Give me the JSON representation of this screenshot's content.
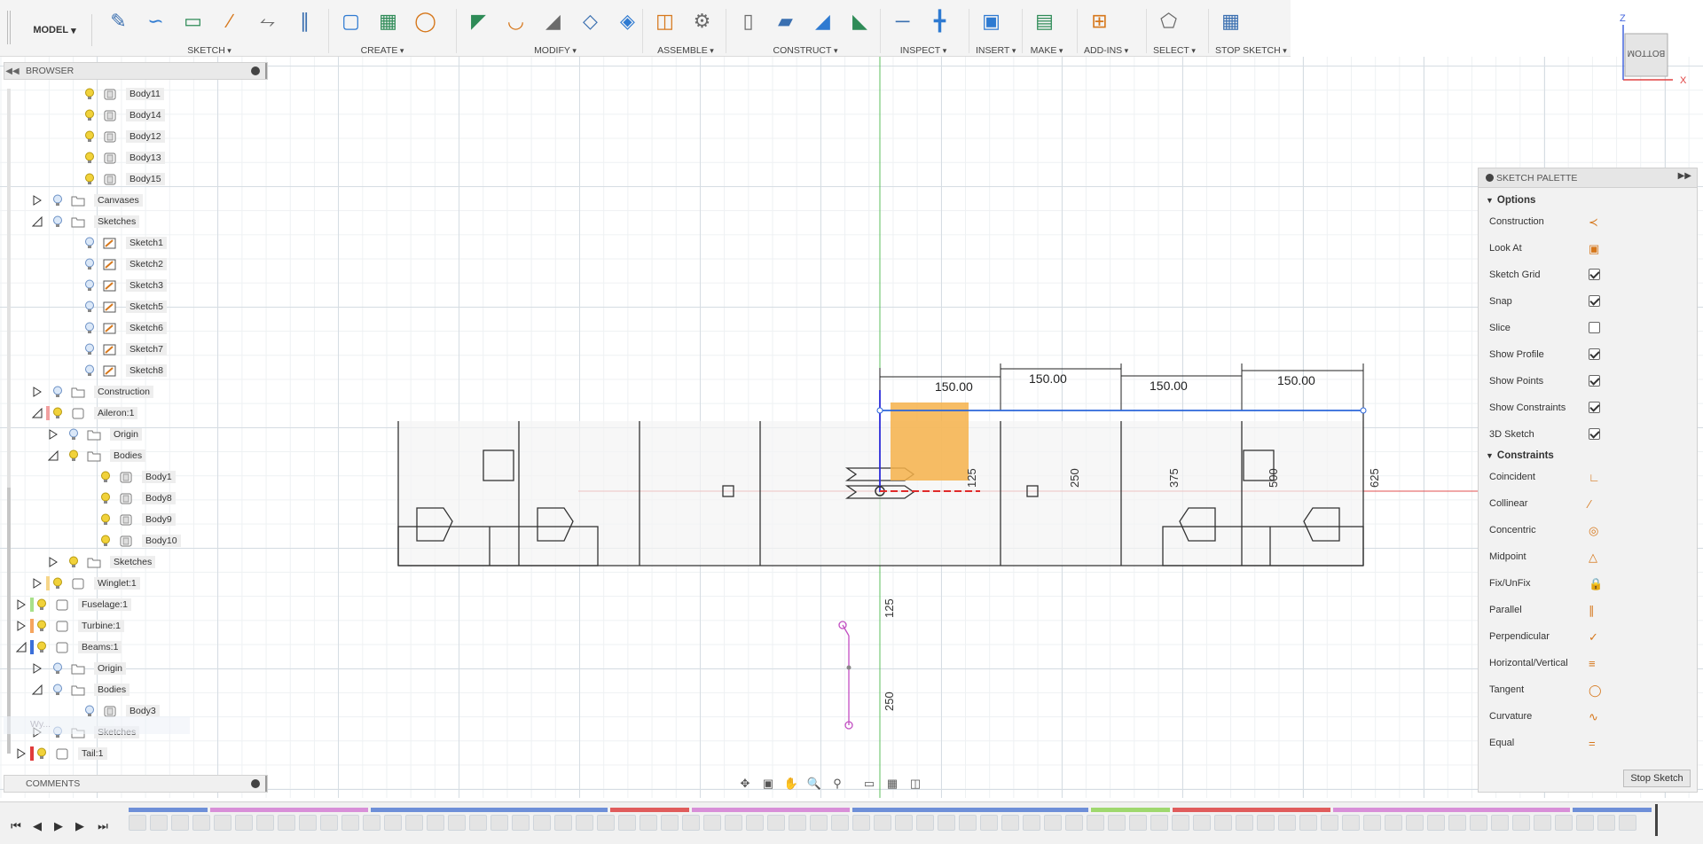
{
  "toolbar": {
    "workspace": "MODEL",
    "groups": [
      {
        "label": "SKETCH",
        "icons": [
          "create-sketch-icon",
          "spline-icon",
          "rectangle-icon",
          "construction-line-icon",
          "offset-icon",
          "mirror-icon"
        ]
      },
      {
        "label": "CREATE",
        "icons": [
          "extrude-icon",
          "form-icon",
          "revolve-icon"
        ]
      },
      {
        "label": "MODIFY",
        "icons": [
          "press-pull-icon",
          "fillet-icon",
          "chamfer-icon",
          "shell-icon",
          "combine-icon"
        ]
      },
      {
        "label": "ASSEMBLE",
        "icons": [
          "new-component-icon",
          "joint-icon"
        ]
      },
      {
        "label": "CONSTRUCT",
        "icons": [
          "offset-plane-icon",
          "plane-at-angle-icon",
          "tangent-plane-icon",
          "midplane-icon"
        ]
      },
      {
        "label": "INSPECT",
        "icons": [
          "measure-icon",
          "interference-icon"
        ]
      },
      {
        "label": "INSERT",
        "icons": [
          "insert-image-icon"
        ]
      },
      {
        "label": "MAKE",
        "icons": [
          "3d-print-icon"
        ]
      },
      {
        "label": "ADD-INS",
        "icons": [
          "scripts-icon"
        ]
      },
      {
        "label": "SELECT",
        "icons": [
          "select-icon"
        ]
      },
      {
        "label": "STOP SKETCH",
        "icons": [
          "stop-sketch-icon"
        ]
      }
    ]
  },
  "browser": {
    "title": "BROWSER",
    "items": [
      {
        "label": "Body11",
        "type": "body"
      },
      {
        "label": "Body14",
        "type": "body"
      },
      {
        "label": "Body12",
        "type": "body"
      },
      {
        "label": "Body13",
        "type": "body"
      },
      {
        "label": "Body15",
        "type": "body"
      },
      {
        "label": "Canvases",
        "type": "folder"
      },
      {
        "label": "Sketches",
        "type": "folder"
      },
      {
        "label": "Sketch1",
        "type": "sketch"
      },
      {
        "label": "Sketch2",
        "type": "sketch"
      },
      {
        "label": "Sketch3",
        "type": "sketch"
      },
      {
        "label": "Sketch5",
        "type": "sketch"
      },
      {
        "label": "Sketch6",
        "type": "sketch"
      },
      {
        "label": "Sketch7",
        "type": "sketch"
      },
      {
        "label": "Sketch8",
        "type": "sketch"
      },
      {
        "label": "Construction",
        "type": "folder"
      },
      {
        "label": "Aileron:1",
        "type": "component"
      },
      {
        "label": "Origin",
        "type": "folder"
      },
      {
        "label": "Bodies",
        "type": "folder"
      },
      {
        "label": "Body1",
        "type": "body"
      },
      {
        "label": "Body8",
        "type": "body"
      },
      {
        "label": "Body9",
        "type": "body"
      },
      {
        "label": "Body10",
        "type": "body"
      },
      {
        "label": "Sketches",
        "type": "folder"
      },
      {
        "label": "Winglet:1",
        "type": "component"
      },
      {
        "label": "Fuselage:1",
        "type": "component"
      },
      {
        "label": "Turbine:1",
        "type": "component"
      },
      {
        "label": "Beams:1",
        "type": "component"
      },
      {
        "label": "Origin",
        "type": "folder"
      },
      {
        "label": "Bodies",
        "type": "folder"
      },
      {
        "label": "Body3",
        "type": "body"
      },
      {
        "label": "Sketches",
        "type": "folder"
      },
      {
        "label": "Tail:1",
        "type": "component"
      }
    ],
    "ghost_label": "Wy..."
  },
  "comments": {
    "title": "COMMENTS"
  },
  "viewcube": {
    "face": "BOTTOM",
    "axis_z": "Z",
    "axis_x": "X"
  },
  "sketch": {
    "dimensions": [
      "150.00",
      "150.00",
      "150.00",
      "150.00"
    ],
    "vertical_labels": [
      "125",
      "250",
      "375",
      "500",
      "625"
    ],
    "lower_labels": [
      "125",
      "250"
    ]
  },
  "palette": {
    "title": "SKETCH PALETTE",
    "options_title": "Options",
    "options": [
      {
        "label": "Construction",
        "control": "icon",
        "icon": "construction-icon"
      },
      {
        "label": "Look At",
        "control": "icon",
        "icon": "look-at-icon"
      },
      {
        "label": "Sketch Grid",
        "control": "checkbox",
        "checked": true
      },
      {
        "label": "Snap",
        "control": "checkbox",
        "checked": true
      },
      {
        "label": "Slice",
        "control": "checkbox",
        "checked": false
      },
      {
        "label": "Show Profile",
        "control": "checkbox",
        "checked": true
      },
      {
        "label": "Show Points",
        "control": "checkbox",
        "checked": true
      },
      {
        "label": "Show Constraints",
        "control": "checkbox",
        "checked": true
      },
      {
        "label": "3D Sketch",
        "control": "checkbox",
        "checked": true
      }
    ],
    "constraints_title": "Constraints",
    "constraints": [
      {
        "label": "Coincident",
        "icon": "coincident-icon"
      },
      {
        "label": "Collinear",
        "icon": "collinear-icon"
      },
      {
        "label": "Concentric",
        "icon": "concentric-icon"
      },
      {
        "label": "Midpoint",
        "icon": "midpoint-icon"
      },
      {
        "label": "Fix/UnFix",
        "icon": "fix-icon"
      },
      {
        "label": "Parallel",
        "icon": "parallel-icon"
      },
      {
        "label": "Perpendicular",
        "icon": "perpendicular-icon"
      },
      {
        "label": "Horizontal/Vertical",
        "icon": "horizontal-vertical-icon"
      },
      {
        "label": "Tangent",
        "icon": "tangent-icon"
      },
      {
        "label": "Curvature",
        "icon": "curvature-icon"
      },
      {
        "label": "Equal",
        "icon": "equal-icon"
      }
    ],
    "stop_label": "Stop Sketch"
  },
  "colors": {
    "accent_orange": "#d6771b",
    "sketch_blue": "#1f5fd6",
    "profile_fill": "#f6b24a",
    "axis_red": "#e03c3c",
    "axis_green": "#3cb43c",
    "constraint_purple": "#c24fc2"
  }
}
